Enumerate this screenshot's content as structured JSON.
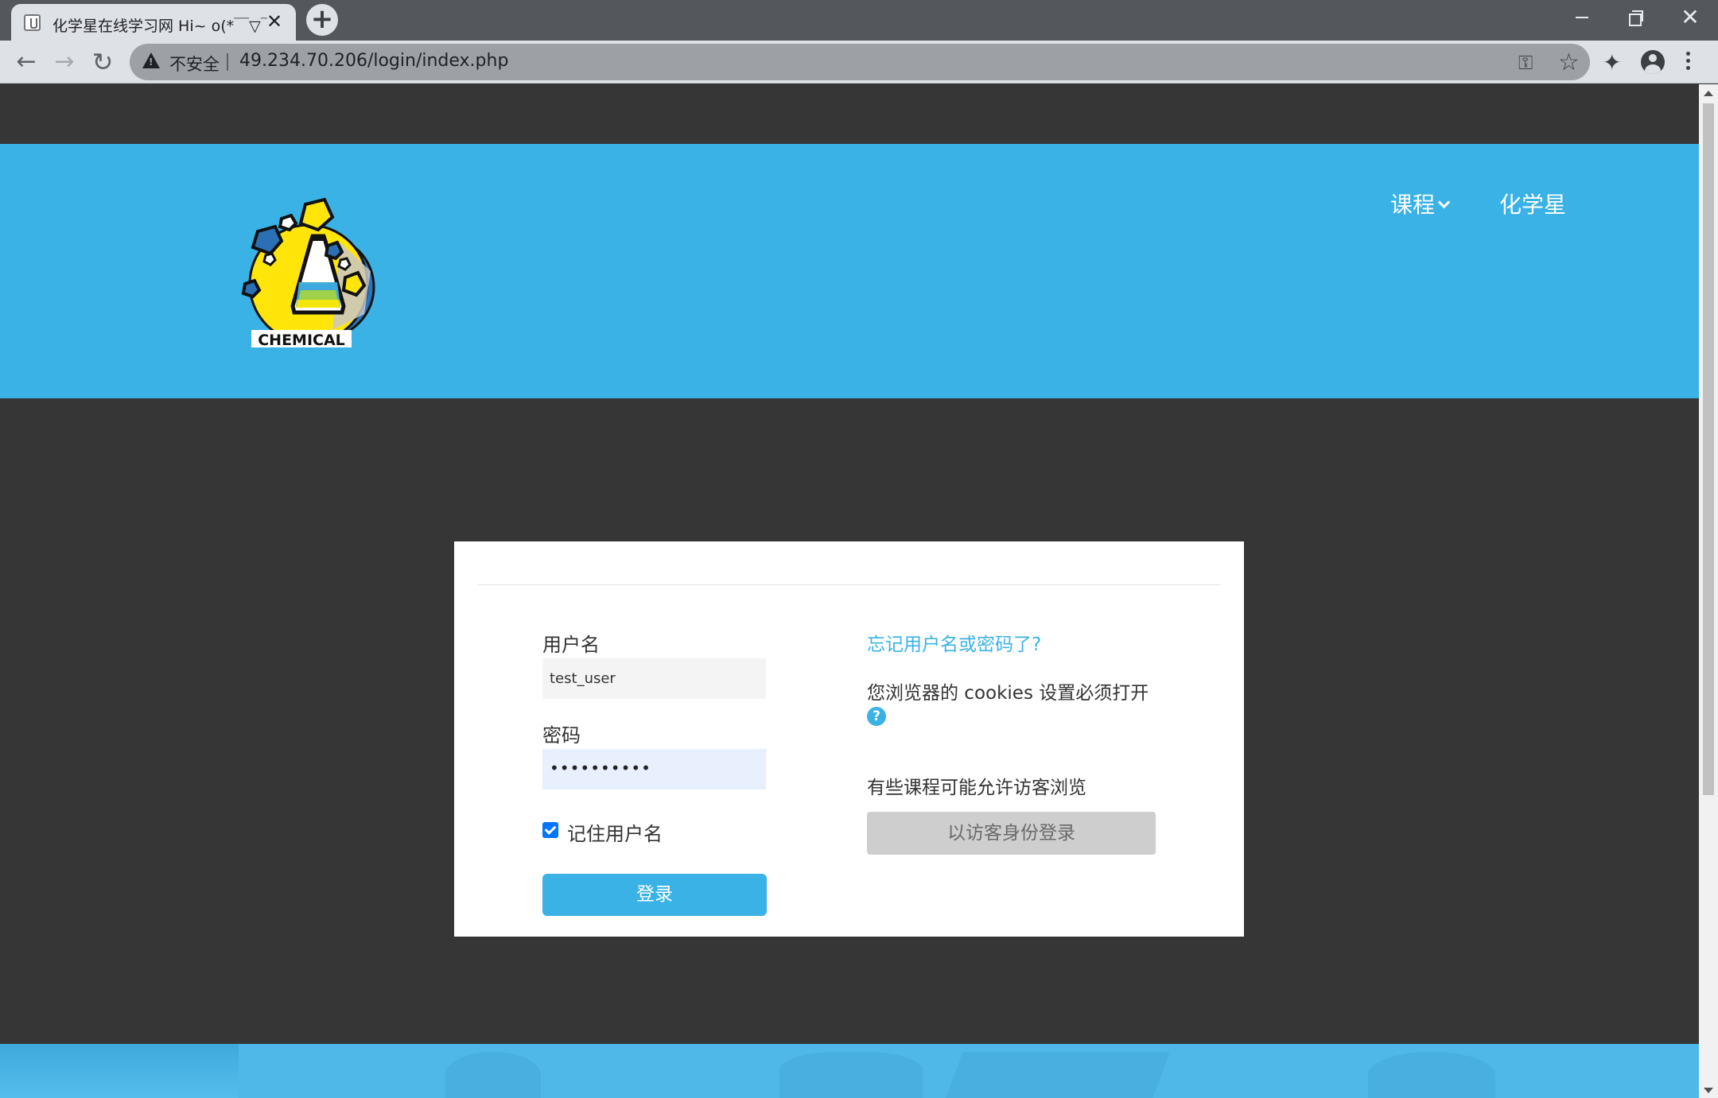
{
  "browser": {
    "tab_title": "化学星在线学习网 Hi~ o(*￣▽￣",
    "tab_close": "✕",
    "new_tab": "+",
    "security_label": "不安全",
    "url": "49.234.70.206/login/index.php",
    "window_close": "✕"
  },
  "icons": {
    "back": "arrow-left-icon",
    "forward": "arrow-right-icon",
    "reload": "reload-icon",
    "warning": "warning-triangle-icon",
    "key": "key-icon",
    "star": "star-icon",
    "extensions": "puzzle-icon",
    "profile": "profile-icon",
    "menu": "kebab-menu-icon",
    "help": "question-circle-icon"
  },
  "header": {
    "nav_courses": "课程",
    "nav_brand": "化学星",
    "logo_text": "CHEMICAL",
    "background": "#3ab2e6"
  },
  "login": {
    "username_label": "用户名",
    "username_value": "test_user",
    "password_label": "密码",
    "password_value": "••••••••••",
    "remember_label": "记住用户名",
    "remember_checked": true,
    "login_button": "登录",
    "forgot_link": "忘记用户名或密码了?",
    "cookies_text": "您浏览器的 cookies 设置必须打开",
    "help_glyph": "?",
    "guest_text": "有些课程可能允许访客浏览",
    "guest_button": "以访客身份登录"
  },
  "colors": {
    "accent": "#3ab2e6",
    "page_bg": "#363636",
    "checkbox": "#0075ff"
  }
}
